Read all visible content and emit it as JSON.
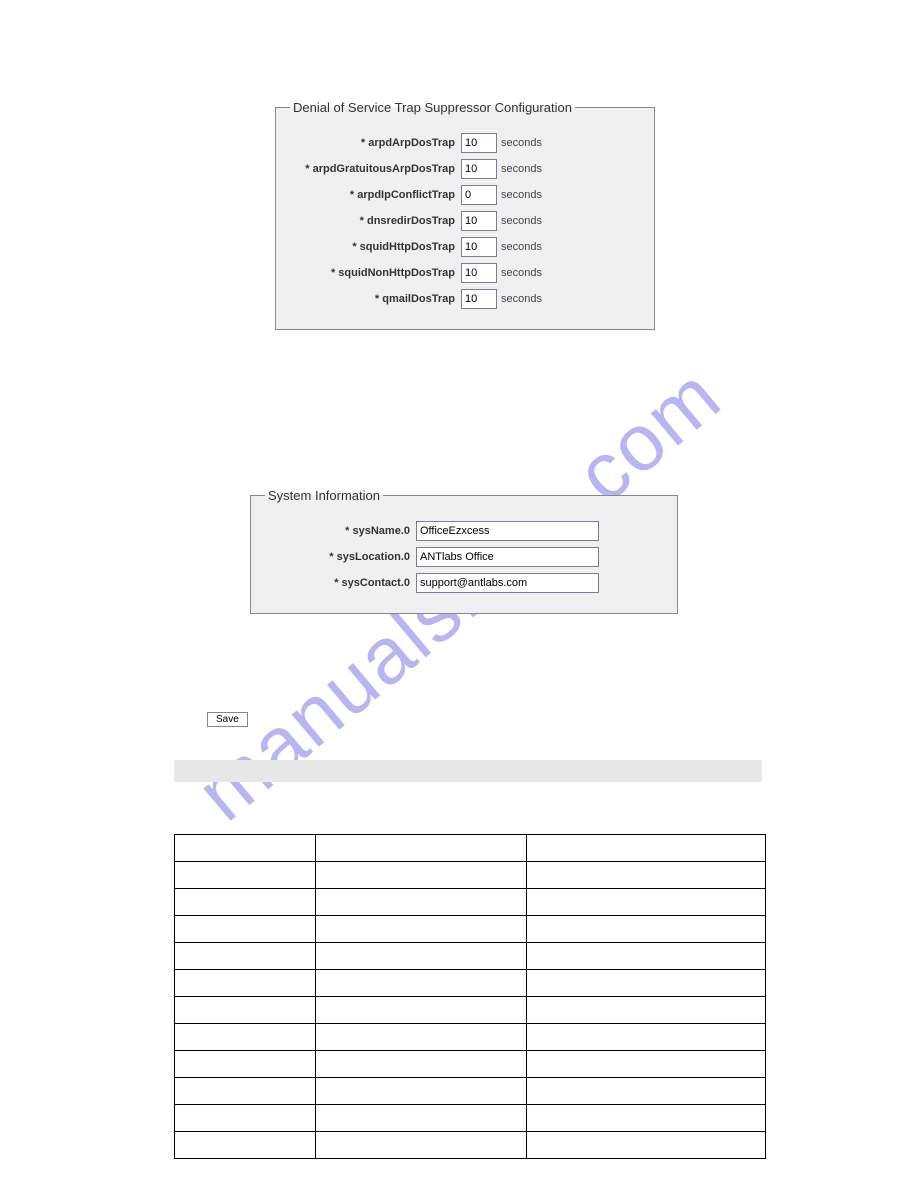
{
  "watermark": "manualshive.com",
  "dos_panel": {
    "legend": "Denial of Service Trap Suppressor Configuration",
    "unit": "seconds",
    "rows": [
      {
        "label": "* arpdArpDosTrap",
        "value": "10"
      },
      {
        "label": "* arpdGratuitousArpDosTrap",
        "value": "10"
      },
      {
        "label": "* arpdIpConflictTrap",
        "value": "0"
      },
      {
        "label": "* dnsredirDosTrap",
        "value": "10"
      },
      {
        "label": "* squidHttpDosTrap",
        "value": "10"
      },
      {
        "label": "* squidNonHttpDosTrap",
        "value": "10"
      },
      {
        "label": "* qmailDosTrap",
        "value": "10"
      }
    ]
  },
  "sys_panel": {
    "legend": "System Information",
    "rows": [
      {
        "label": "* sysName.0",
        "value": "OfficeEzxcess"
      },
      {
        "label": "* sysLocation.0",
        "value": "ANTlabs Office"
      },
      {
        "label": "* sysContact.0",
        "value": "support@antlabs.com"
      }
    ]
  },
  "buttons": {
    "save": "Save"
  },
  "table": {
    "cols": 3,
    "body_rows": 11
  }
}
